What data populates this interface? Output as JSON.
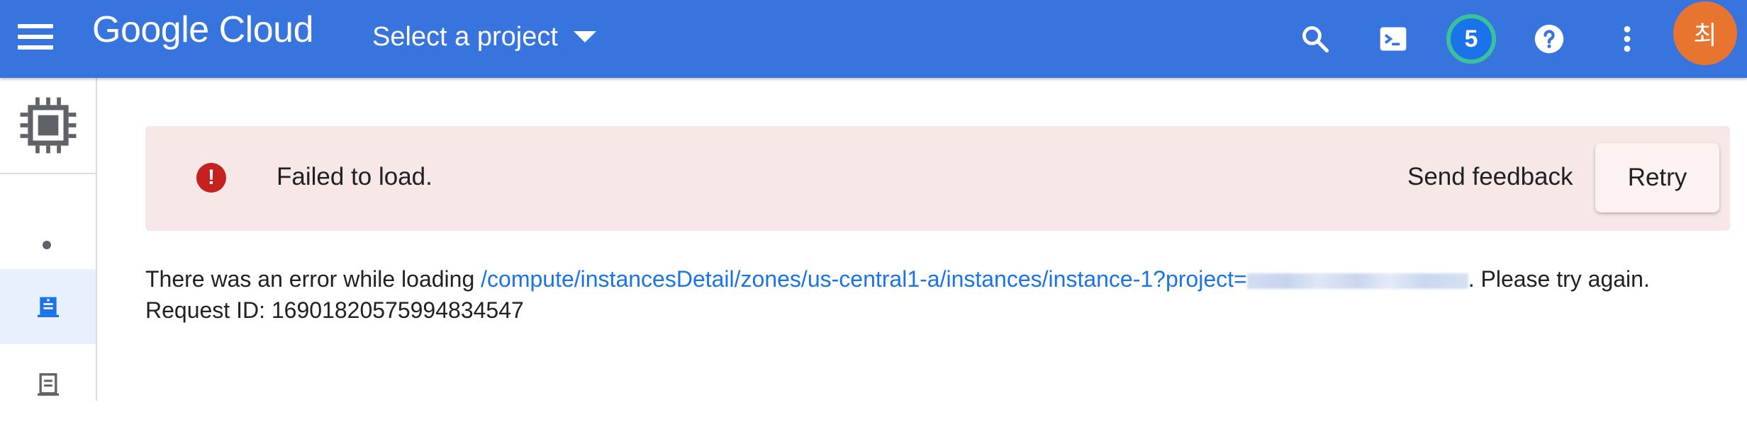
{
  "header": {
    "brand": "Google Cloud",
    "project_selector": "Select a project",
    "notifications_count": "5",
    "avatar_initial": "최"
  },
  "banner": {
    "message": "Failed to load.",
    "send_feedback": "Send feedback",
    "retry": "Retry"
  },
  "error": {
    "prefix": "There was an error while loading",
    "link": "/compute/instancesDetail/zones/us-central1-a/instances/instance-1?project=",
    "suffix": ". Please try again.",
    "request_id": "Request ID: 16901820575994834547"
  },
  "colors": {
    "topbar": "#3874de",
    "banner_bg": "#f7e7e6",
    "error_icon": "#c5221f",
    "link": "#1a73e8",
    "avatar": "#e8752f"
  }
}
